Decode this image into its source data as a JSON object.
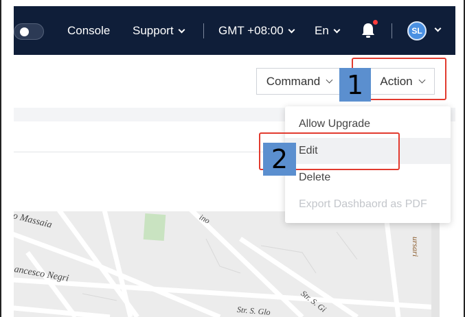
{
  "navbar": {
    "console": "Console",
    "support": "Support",
    "timezone": "GMT +08:00",
    "language": "En",
    "avatar_initials": "SL"
  },
  "toolbar": {
    "command_label": "Command",
    "action_label": "Action"
  },
  "action_menu": {
    "items": [
      {
        "label": "Allow Upgrade",
        "state": "normal"
      },
      {
        "label": "Edit",
        "state": "hover"
      },
      {
        "label": "Delete",
        "state": "normal"
      },
      {
        "label": "Export Dashbaord as PDF",
        "state": "disabled"
      }
    ]
  },
  "annotations": {
    "step1": "1",
    "step2": "2",
    "color": "#e23a2e"
  },
  "map": {
    "labels": [
      "o Massaia",
      "ancesco Negri",
      "ino",
      "Str. S. Glo",
      "Str. S. Gi",
      "ursari"
    ]
  },
  "colors": {
    "navbar_bg": "#0f1e39",
    "accent_blue": "#4a90e2",
    "badge_bg": "#5b8fcf"
  }
}
